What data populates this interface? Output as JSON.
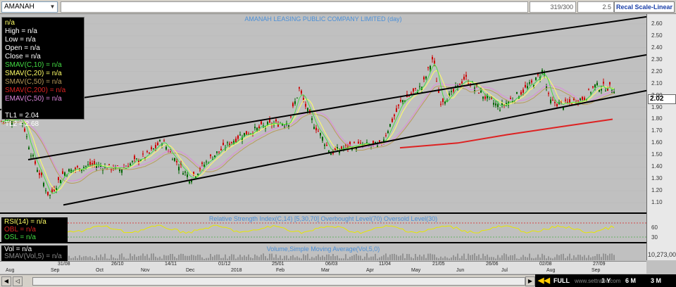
{
  "toolbar": {
    "symbol": "AMANAH",
    "counter": "319/300",
    "value_field": "2.5",
    "recal_label": "Recal Scale-Linear"
  },
  "main": {
    "title": "AMANAH LEASING PUBLIC COMPANY LIMITED (day)",
    "info": [
      {
        "text": "n/a",
        "color": "#ffff66"
      },
      {
        "text": "High  = n/a",
        "color": "#ffffff"
      },
      {
        "text": "Low  = n/a",
        "color": "#ffffff"
      },
      {
        "text": "Open  = n/a",
        "color": "#ffffff"
      },
      {
        "text": "Close  = n/a",
        "color": "#ffffff"
      },
      {
        "text": "SMAV(C,10)   = n/a",
        "color": "#44dd44"
      },
      {
        "text": "SMAV(C,20)   = n/a",
        "color": "#ffff66"
      },
      {
        "text": "SMAV(C,50)   = n/a",
        "color": "#b89a5a"
      },
      {
        "text": "SMAV(C,200)   = n/a",
        "color": "#dd2222"
      },
      {
        "text": "EMAV(C,50)   = n/a",
        "color": "#dd88dd"
      },
      {
        "text": "",
        "color": "#ffffff"
      },
      {
        "text": "TL1 = 2.04",
        "color": "#ffffff"
      },
      {
        "text": "TL2 = 2.68",
        "color": "#ffffff"
      }
    ],
    "price_labels": [
      "2.60",
      "2.50",
      "2.40",
      "2.30",
      "2.20",
      "2.10",
      "2.00",
      "1.90",
      "1.80",
      "1.70",
      "1.60",
      "1.50",
      "1.40",
      "1.30",
      "1.20",
      "1.10"
    ],
    "last_price": "2.02"
  },
  "rsi": {
    "title": "Relative Strength Index(C,14) [5,30,70]  Overbought Level(70)  Oversold Level(30)",
    "info": [
      {
        "text": "RSI(14)   = n/a",
        "color": "#ffff66"
      },
      {
        "text": "OBL    = n/a",
        "color": "#dd2222"
      },
      {
        "text": "OSL    = n/a",
        "color": "#44dd44"
      }
    ],
    "labels": [
      "60",
      "30"
    ]
  },
  "volume": {
    "title": "Volume,Simple Moving Average(Vol,5,0)",
    "info": [
      {
        "text": "Vol   = n/a",
        "color": "#ffffff"
      },
      {
        "text": "SMAV(Vol,5)   = n/a",
        "color": "#888888"
      }
    ],
    "label": "10,273,00"
  },
  "date_axis": {
    "upper": [
      "31/08",
      "26/10",
      "14/11",
      "01/12",
      "25/01",
      "06/03",
      "11/04",
      "21/05",
      "26/06",
      "02/08",
      "27/09"
    ],
    "lower": [
      "Aug",
      "Sep",
      "Oct",
      "Nov",
      "Dec",
      "2018",
      "Feb",
      "Mar",
      "Apr",
      "May",
      "Jun",
      "Jul",
      "Aug",
      "Sep"
    ]
  },
  "period_buttons": [
    "FULL",
    "1 Y",
    "6 M",
    "3 M"
  ],
  "watermark": "www.settrade.com"
}
